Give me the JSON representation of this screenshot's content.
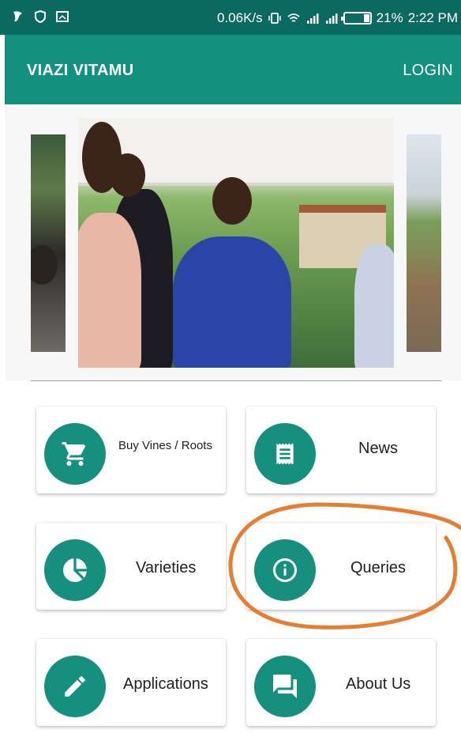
{
  "status_bar": {
    "speed": "0.06K/s",
    "battery": "21%",
    "time": "2:22 PM"
  },
  "app_bar": {
    "title": "VIAZI VITAMU",
    "login_label": "LOGIN"
  },
  "menu": {
    "buy": "Buy Vines / Roots",
    "news": "News",
    "varieties": "Varieties",
    "queries": "Queries",
    "applications": "Applications",
    "about": "About Us"
  },
  "colors": {
    "status_bar": "#0b6a5f",
    "app_bar": "#13907f",
    "accent_circle": "#16907e",
    "annotation": "#e67e32"
  },
  "icons": {
    "buy": "cart-icon",
    "news": "receipt-icon",
    "varieties": "pie-icon",
    "queries": "info-icon",
    "applications": "pencil-icon",
    "about": "chat-icon"
  }
}
